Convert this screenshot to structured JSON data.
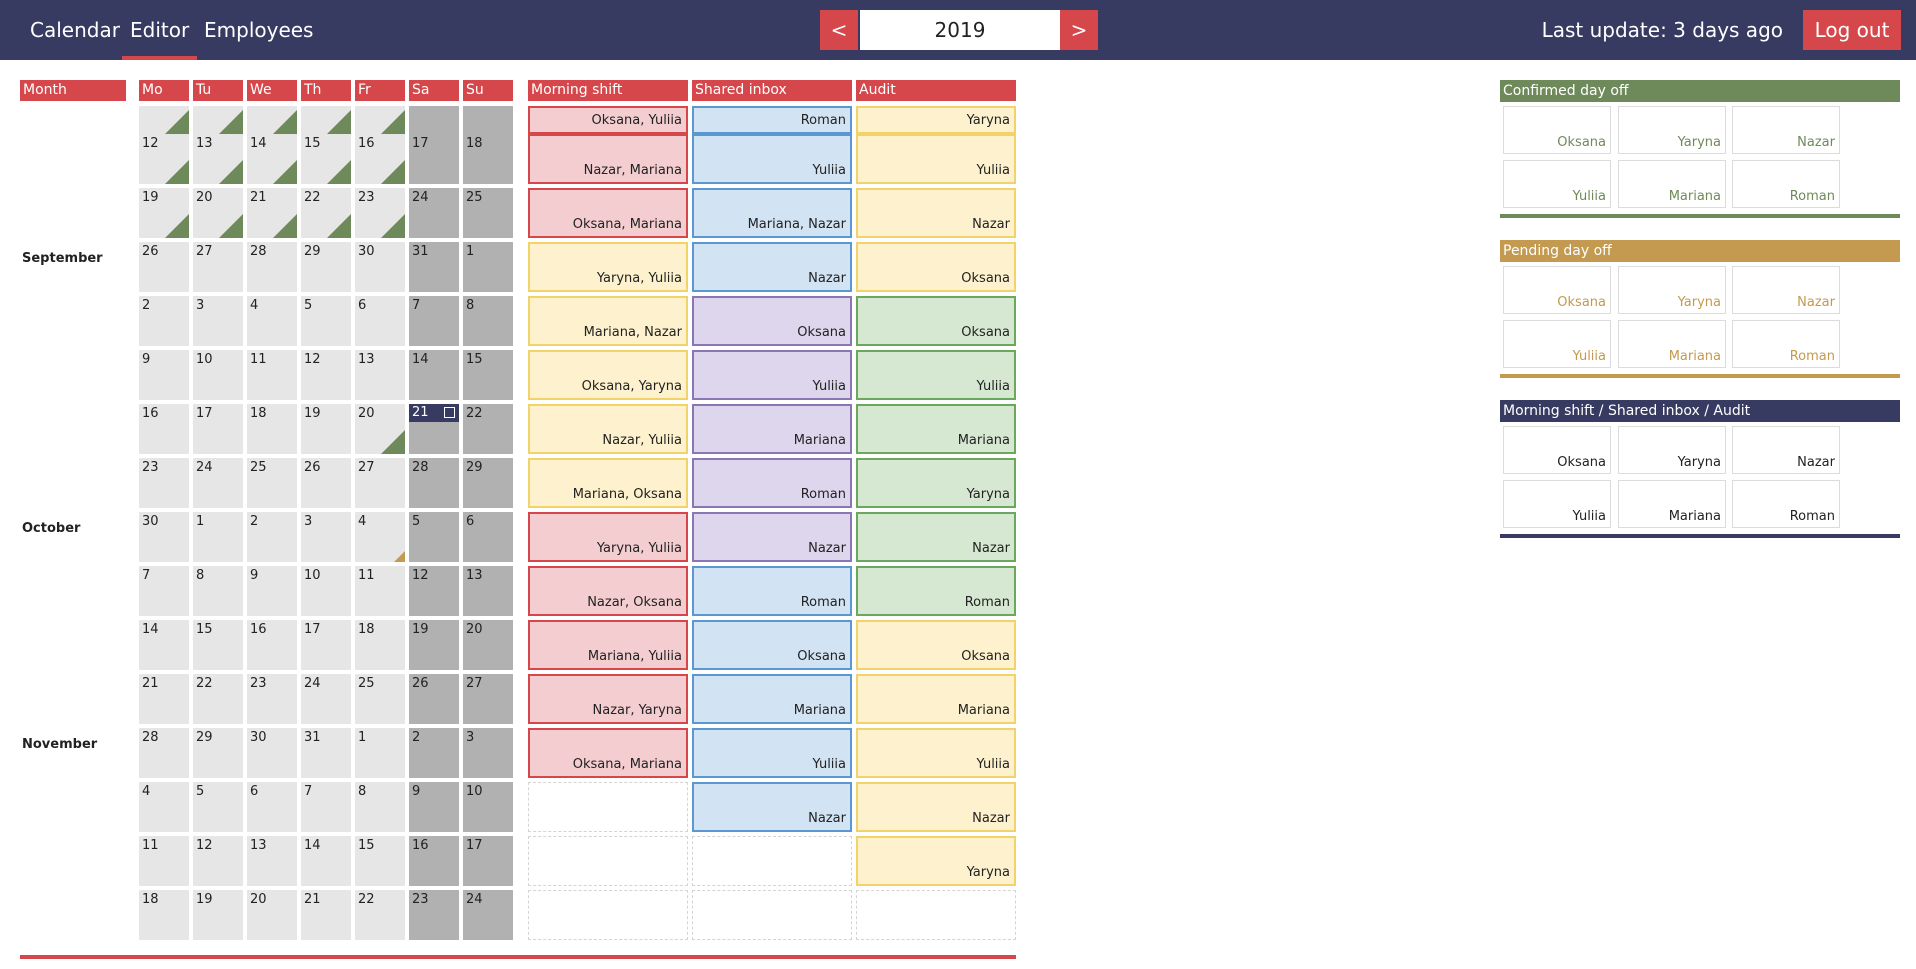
{
  "nav": {
    "calendar": "Calendar",
    "editor": "Editor",
    "employees": "Employees",
    "prev": "<",
    "year": "2019",
    "next": ">",
    "last_update": "Last update: 3 days ago",
    "logout": "Log out"
  },
  "headers": {
    "month": "Month",
    "weekdays": [
      "Mo",
      "Tu",
      "We",
      "Th",
      "Fr",
      "Sa",
      "Su"
    ],
    "morning": "Morning shift",
    "inbox": "Shared inbox",
    "audit": "Audit"
  },
  "colors": {
    "navy": "#383b61",
    "accent_red": "#d6474c",
    "confirmed_green": "#6f8a5a",
    "pending_gold": "#c39a4f"
  },
  "weeks": [
    {
      "month": "",
      "days": [
        "",
        "",
        "",
        "",
        "",
        "",
        ""
      ],
      "confirmed": [
        0,
        1,
        2,
        3,
        4
      ],
      "pending": [],
      "morning": {
        "names": "Oksana, Yuliia",
        "color": "red"
      },
      "inbox": {
        "names": "Roman",
        "color": "blue"
      },
      "audit": {
        "names": "Yaryna",
        "color": "yellow"
      }
    },
    {
      "month": "",
      "days": [
        "12",
        "13",
        "14",
        "15",
        "16",
        "17",
        "18"
      ],
      "confirmed": [
        0,
        1,
        2,
        3,
        4
      ],
      "pending": [],
      "morning": {
        "names": "Nazar, Mariana",
        "color": "red"
      },
      "inbox": {
        "names": "Yuliia",
        "color": "blue"
      },
      "audit": {
        "names": "Yuliia",
        "color": "yellow"
      }
    },
    {
      "month": "",
      "days": [
        "19",
        "20",
        "21",
        "22",
        "23",
        "24",
        "25"
      ],
      "confirmed": [
        0,
        1,
        2,
        3,
        4
      ],
      "pending": [],
      "morning": {
        "names": "Oksana, Mariana",
        "color": "red"
      },
      "inbox": {
        "names": "Mariana, Nazar",
        "color": "blue"
      },
      "audit": {
        "names": "Nazar",
        "color": "yellow"
      }
    },
    {
      "month": "September",
      "days": [
        "26",
        "27",
        "28",
        "29",
        "30",
        "31",
        "1"
      ],
      "confirmed": [],
      "pending": [],
      "morning": {
        "names": "Yaryna, Yuliia",
        "color": "yellow"
      },
      "inbox": {
        "names": "Nazar",
        "color": "blue"
      },
      "audit": {
        "names": "Oksana",
        "color": "yellow"
      }
    },
    {
      "month": "",
      "days": [
        "2",
        "3",
        "4",
        "5",
        "6",
        "7",
        "8"
      ],
      "confirmed": [],
      "pending": [],
      "morning": {
        "names": "Mariana, Nazar",
        "color": "yellow"
      },
      "inbox": {
        "names": "Oksana",
        "color": "purple"
      },
      "audit": {
        "names": "Oksana",
        "color": "green"
      }
    },
    {
      "month": "",
      "days": [
        "9",
        "10",
        "11",
        "12",
        "13",
        "14",
        "15"
      ],
      "confirmed": [],
      "pending": [],
      "morning": {
        "names": "Oksana, Yaryna",
        "color": "yellow"
      },
      "inbox": {
        "names": "Yuliia",
        "color": "purple"
      },
      "audit": {
        "names": "Yuliia",
        "color": "green"
      }
    },
    {
      "month": "",
      "days": [
        "16",
        "17",
        "18",
        "19",
        "20",
        "21",
        "22"
      ],
      "confirmed": [
        4
      ],
      "pending": [],
      "today": 5,
      "morning": {
        "names": "Nazar, Yuliia",
        "color": "yellow"
      },
      "inbox": {
        "names": "Mariana",
        "color": "purple"
      },
      "audit": {
        "names": "Mariana",
        "color": "green"
      }
    },
    {
      "month": "",
      "days": [
        "23",
        "24",
        "25",
        "26",
        "27",
        "28",
        "29"
      ],
      "confirmed": [],
      "pending": [],
      "morning": {
        "names": "Mariana, Oksana",
        "color": "yellow"
      },
      "inbox": {
        "names": "Roman",
        "color": "purple"
      },
      "audit": {
        "names": "Yaryna",
        "color": "green"
      }
    },
    {
      "month": "October",
      "days": [
        "30",
        "1",
        "2",
        "3",
        "4",
        "5",
        "6"
      ],
      "confirmed": [],
      "pending": [
        4
      ],
      "morning": {
        "names": "Yaryna, Yuliia",
        "color": "red"
      },
      "inbox": {
        "names": "Nazar",
        "color": "purple"
      },
      "audit": {
        "names": "Nazar",
        "color": "green"
      }
    },
    {
      "month": "",
      "days": [
        "7",
        "8",
        "9",
        "10",
        "11",
        "12",
        "13"
      ],
      "confirmed": [],
      "pending": [],
      "morning": {
        "names": "Nazar, Oksana",
        "color": "red"
      },
      "inbox": {
        "names": "Roman",
        "color": "blue"
      },
      "audit": {
        "names": "Roman",
        "color": "green"
      }
    },
    {
      "month": "",
      "days": [
        "14",
        "15",
        "16",
        "17",
        "18",
        "19",
        "20"
      ],
      "confirmed": [],
      "pending": [],
      "morning": {
        "names": "Mariana, Yuliia",
        "color": "red"
      },
      "inbox": {
        "names": "Oksana",
        "color": "blue"
      },
      "audit": {
        "names": "Oksana",
        "color": "yellow"
      }
    },
    {
      "month": "",
      "days": [
        "21",
        "22",
        "23",
        "24",
        "25",
        "26",
        "27"
      ],
      "confirmed": [],
      "pending": [],
      "morning": {
        "names": "Nazar, Yaryna",
        "color": "red"
      },
      "inbox": {
        "names": "Mariana",
        "color": "blue"
      },
      "audit": {
        "names": "Mariana",
        "color": "yellow"
      }
    },
    {
      "month": "November",
      "days": [
        "28",
        "29",
        "30",
        "31",
        "1",
        "2",
        "3"
      ],
      "confirmed": [],
      "pending": [],
      "morning": {
        "names": "Oksana, Mariana",
        "color": "red"
      },
      "inbox": {
        "names": "Yuliia",
        "color": "blue"
      },
      "audit": {
        "names": "Yuliia",
        "color": "yellow"
      }
    },
    {
      "month": "",
      "days": [
        "4",
        "5",
        "6",
        "7",
        "8",
        "9",
        "10"
      ],
      "confirmed": [],
      "pending": [],
      "morning": {
        "names": "",
        "color": "empty"
      },
      "inbox": {
        "names": "Nazar",
        "color": "blue"
      },
      "audit": {
        "names": "Nazar",
        "color": "yellow"
      }
    },
    {
      "month": "",
      "days": [
        "11",
        "12",
        "13",
        "14",
        "15",
        "16",
        "17"
      ],
      "confirmed": [],
      "pending": [],
      "morning": {
        "names": "",
        "color": "empty"
      },
      "inbox": {
        "names": "",
        "color": "empty"
      },
      "audit": {
        "names": "Yaryna",
        "color": "yellow"
      }
    },
    {
      "month": "",
      "days": [
        "18",
        "19",
        "20",
        "21",
        "22",
        "23",
        "24"
      ],
      "confirmed": [],
      "pending": [],
      "morning": {
        "names": "",
        "color": "empty"
      },
      "inbox": {
        "names": "",
        "color": "empty"
      },
      "audit": {
        "names": "",
        "color": "empty"
      }
    }
  ],
  "panels": [
    {
      "title": "Confirmed day off",
      "color": "#6f8a5a",
      "text_color": "#6f8a5a",
      "employees": [
        "Oksana",
        "Yaryna",
        "Nazar",
        "Yuliia",
        "Mariana",
        "Roman"
      ]
    },
    {
      "title": "Pending day off",
      "color": "#c39a4f",
      "text_color": "#c39a4f",
      "employees": [
        "Oksana",
        "Yaryna",
        "Nazar",
        "Yuliia",
        "Mariana",
        "Roman"
      ]
    },
    {
      "title": "Morning shift / Shared inbox / Audit",
      "color": "#383b61",
      "text_color": "#222222",
      "employees": [
        "Oksana",
        "Yaryna",
        "Nazar",
        "Yuliia",
        "Mariana",
        "Roman"
      ]
    }
  ]
}
